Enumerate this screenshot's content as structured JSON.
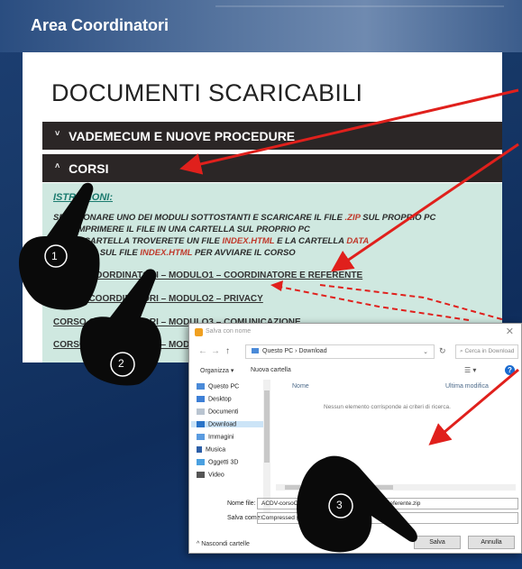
{
  "header": {
    "title": "Area Coordinatori"
  },
  "page": {
    "heading": "DOCUMENTI SCARICABILI",
    "sections": [
      {
        "caret": "˅",
        "label": "VADEMECUM E NUOVE PROCEDURE"
      },
      {
        "caret": "˄",
        "label": "CORSI"
      }
    ],
    "instructions": {
      "title": "ISTRUZIONI:",
      "line1_pre": "SELEZIONARE UNO DEI MODULI SOTTOSTANTI E SCARICARE IL FILE ",
      "line1_hl": ".ZIP",
      "line1_post": " SUL PROPRIO PC",
      "line2": "DECOMPRIMERE IL FILE IN UNA CARTELLA SUL PROPRIO PC",
      "line3_pre": "NELLA CARTELLA TROVERETE UN FILE ",
      "line3_hl1": "INDEX.HTML",
      "line3_mid": " E LA CARTELLA ",
      "line3_hl2": "DATA",
      "line4_pre": "CLICCARE SUL FILE ",
      "line4_hl": "INDEX.HTML",
      "line4_post": " PER AVVIARE IL CORSO"
    },
    "courses": [
      "CORSO COORDINATORI – MODULO1 – COORDINATORE E REFERENTE",
      "CORSO COORDINATORI – MODULO2 – PRIVACY",
      "CORSO COORDINATORI – MODULO3 – COMUNICAZIONE",
      "CORSO COORDINATORI – MODULO4"
    ]
  },
  "dialog": {
    "title": "Salva con nome",
    "close": "✕",
    "address": "Questo PC  ›  Download",
    "search_placeholder": "Cerca in Download",
    "organize": "Organizza ▾",
    "new_folder": "Nuova cartella",
    "sidebar": [
      "Questo PC",
      "Desktop",
      "Documenti",
      "Download",
      "Immagini",
      "Musica",
      "Oggetti 3D",
      "Video"
    ],
    "columns": {
      "name": "Nome",
      "modified": "Ultima modifica"
    },
    "empty_message": "Nessun elemento corrisponde ai criteri di ricerca.",
    "filename_label": "Nome file:",
    "filename_value": "ACDV-corsoCoordinatori-modulo1-coordinatore_referente.zip",
    "savetype_label": "Salva come:",
    "savetype_value": "Compressed (zipped) Folder",
    "hide_folders": "^ Nascondi cartelle",
    "save_button": "Salva",
    "cancel_button": "Annulla"
  },
  "steps": [
    "1",
    "2",
    "3"
  ],
  "colors": {
    "arrow": "#e0201c",
    "panel": "#cfe8e0",
    "bar": "#2b2626",
    "hand": "#0a0a0a"
  }
}
